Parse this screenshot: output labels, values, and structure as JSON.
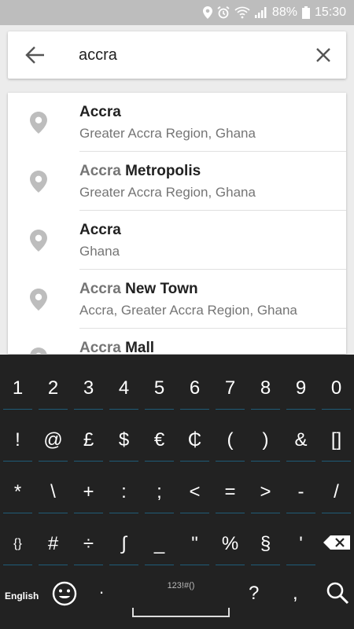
{
  "status_bar": {
    "battery": "88%",
    "time": "15:30",
    "icons": [
      "location-pin-icon",
      "alarm-icon",
      "wifi-calling-icon",
      "signal-icon",
      "battery-icon"
    ]
  },
  "search": {
    "query": "accra",
    "back_icon": "back-arrow-icon",
    "clear_icon": "close-icon"
  },
  "results": [
    {
      "highlight": "Accra",
      "rest": "",
      "subtitle": "Greater Accra Region, Ghana"
    },
    {
      "highlight": "Accra",
      "rest": " Metropolis",
      "subtitle": "Greater Accra Region, Ghana"
    },
    {
      "highlight": "Accra",
      "rest": "",
      "subtitle": "Ghana"
    },
    {
      "highlight": "Accra",
      "rest": " New Town",
      "subtitle": "Accra, Greater Accra Region, Ghana"
    },
    {
      "highlight": "Accra",
      "rest": " Mall",
      "subtitle": ""
    }
  ],
  "keyboard": {
    "rows": [
      [
        "1",
        "2",
        "3",
        "4",
        "5",
        "6",
        "7",
        "8",
        "9",
        "0"
      ],
      [
        "!",
        "@",
        "£",
        "$",
        "€",
        "₵",
        "(",
        ")",
        "&",
        "[]"
      ],
      [
        "*",
        "\\",
        "+",
        ":",
        ";",
        "<",
        "=",
        ">",
        "-",
        "/"
      ],
      [
        "{}",
        "#",
        "÷",
        "∫",
        "_",
        "\"",
        "%",
        "§",
        "'"
      ]
    ],
    "backspace_icon": "backspace-icon",
    "language": "English",
    "emoji_icon": "emoji-icon",
    "period": ".",
    "space_label": "123!#()",
    "question": "?",
    "comma": ",",
    "search_icon": "search-icon",
    "accent_color": "#1f5c78"
  }
}
